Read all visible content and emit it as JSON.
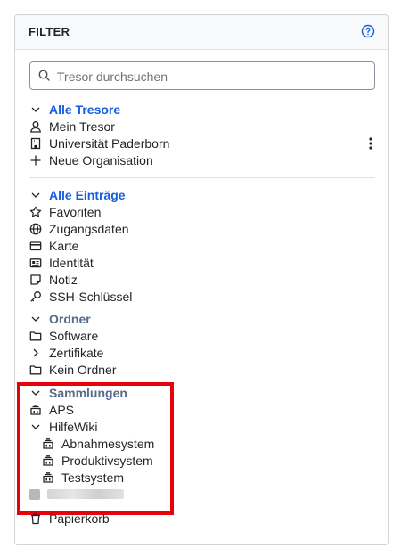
{
  "panel": {
    "title": "FILTER",
    "help_icon": "question-circle-icon"
  },
  "search": {
    "placeholder": "Tresor durchsuchen",
    "value": ""
  },
  "vaults": {
    "header": "Alle Tresore",
    "items": [
      {
        "label": "Mein Tresor",
        "icon": "user-icon"
      },
      {
        "label": "Universität Paderborn",
        "icon": "building-icon"
      },
      {
        "label": "Neue Organisation",
        "icon": "plus-icon"
      }
    ]
  },
  "entries": {
    "header": "Alle Einträge",
    "items": [
      {
        "label": "Favoriten",
        "icon": "star-icon"
      },
      {
        "label": "Zugangsdaten",
        "icon": "globe-icon"
      },
      {
        "label": "Karte",
        "icon": "credit-card-icon"
      },
      {
        "label": "Identität",
        "icon": "id-card-icon"
      },
      {
        "label": "Notiz",
        "icon": "note-icon"
      },
      {
        "label": "SSH-Schlüssel",
        "icon": "key-icon"
      }
    ]
  },
  "folders": {
    "header": "Ordner",
    "items": [
      {
        "label": "Software",
        "icon": "folder-icon"
      },
      {
        "label": "Zertifikate",
        "icon": "chevron-right-icon"
      },
      {
        "label": "Kein Ordner",
        "icon": "folder-icon"
      }
    ]
  },
  "collections": {
    "header": "Sammlungen",
    "items": [
      {
        "label": "APS",
        "icon": "collection-icon"
      },
      {
        "label": "HilfeWiki",
        "icon": "chevron-down-icon"
      }
    ],
    "children": [
      {
        "label": "Abnahmesystem",
        "icon": "collection-icon"
      },
      {
        "label": "Produktivsystem",
        "icon": "collection-icon"
      },
      {
        "label": "Testsystem",
        "icon": "collection-icon"
      }
    ]
  },
  "trash": {
    "label": "Papierkorb",
    "icon": "trash-icon"
  },
  "colors": {
    "accent": "#175ddc",
    "highlight": "#e8000b"
  }
}
